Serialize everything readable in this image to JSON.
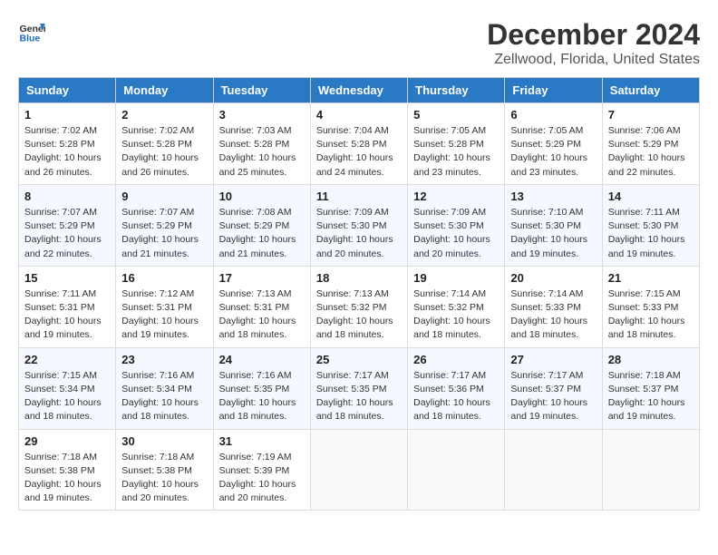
{
  "logo": {
    "line1": "General",
    "line2": "Blue"
  },
  "title": "December 2024",
  "subtitle": "Zellwood, Florida, United States",
  "days_header": [
    "Sunday",
    "Monday",
    "Tuesday",
    "Wednesday",
    "Thursday",
    "Friday",
    "Saturday"
  ],
  "weeks": [
    [
      {
        "day": "1",
        "sunrise": "7:02 AM",
        "sunset": "5:28 PM",
        "daylight": "10 hours and 26 minutes."
      },
      {
        "day": "2",
        "sunrise": "7:02 AM",
        "sunset": "5:28 PM",
        "daylight": "10 hours and 26 minutes."
      },
      {
        "day": "3",
        "sunrise": "7:03 AM",
        "sunset": "5:28 PM",
        "daylight": "10 hours and 25 minutes."
      },
      {
        "day": "4",
        "sunrise": "7:04 AM",
        "sunset": "5:28 PM",
        "daylight": "10 hours and 24 minutes."
      },
      {
        "day": "5",
        "sunrise": "7:05 AM",
        "sunset": "5:28 PM",
        "daylight": "10 hours and 23 minutes."
      },
      {
        "day": "6",
        "sunrise": "7:05 AM",
        "sunset": "5:29 PM",
        "daylight": "10 hours and 23 minutes."
      },
      {
        "day": "7",
        "sunrise": "7:06 AM",
        "sunset": "5:29 PM",
        "daylight": "10 hours and 22 minutes."
      }
    ],
    [
      {
        "day": "8",
        "sunrise": "7:07 AM",
        "sunset": "5:29 PM",
        "daylight": "10 hours and 22 minutes."
      },
      {
        "day": "9",
        "sunrise": "7:07 AM",
        "sunset": "5:29 PM",
        "daylight": "10 hours and 21 minutes."
      },
      {
        "day": "10",
        "sunrise": "7:08 AM",
        "sunset": "5:29 PM",
        "daylight": "10 hours and 21 minutes."
      },
      {
        "day": "11",
        "sunrise": "7:09 AM",
        "sunset": "5:30 PM",
        "daylight": "10 hours and 20 minutes."
      },
      {
        "day": "12",
        "sunrise": "7:09 AM",
        "sunset": "5:30 PM",
        "daylight": "10 hours and 20 minutes."
      },
      {
        "day": "13",
        "sunrise": "7:10 AM",
        "sunset": "5:30 PM",
        "daylight": "10 hours and 19 minutes."
      },
      {
        "day": "14",
        "sunrise": "7:11 AM",
        "sunset": "5:30 PM",
        "daylight": "10 hours and 19 minutes."
      }
    ],
    [
      {
        "day": "15",
        "sunrise": "7:11 AM",
        "sunset": "5:31 PM",
        "daylight": "10 hours and 19 minutes."
      },
      {
        "day": "16",
        "sunrise": "7:12 AM",
        "sunset": "5:31 PM",
        "daylight": "10 hours and 19 minutes."
      },
      {
        "day": "17",
        "sunrise": "7:13 AM",
        "sunset": "5:31 PM",
        "daylight": "10 hours and 18 minutes."
      },
      {
        "day": "18",
        "sunrise": "7:13 AM",
        "sunset": "5:32 PM",
        "daylight": "10 hours and 18 minutes."
      },
      {
        "day": "19",
        "sunrise": "7:14 AM",
        "sunset": "5:32 PM",
        "daylight": "10 hours and 18 minutes."
      },
      {
        "day": "20",
        "sunrise": "7:14 AM",
        "sunset": "5:33 PM",
        "daylight": "10 hours and 18 minutes."
      },
      {
        "day": "21",
        "sunrise": "7:15 AM",
        "sunset": "5:33 PM",
        "daylight": "10 hours and 18 minutes."
      }
    ],
    [
      {
        "day": "22",
        "sunrise": "7:15 AM",
        "sunset": "5:34 PM",
        "daylight": "10 hours and 18 minutes."
      },
      {
        "day": "23",
        "sunrise": "7:16 AM",
        "sunset": "5:34 PM",
        "daylight": "10 hours and 18 minutes."
      },
      {
        "day": "24",
        "sunrise": "7:16 AM",
        "sunset": "5:35 PM",
        "daylight": "10 hours and 18 minutes."
      },
      {
        "day": "25",
        "sunrise": "7:17 AM",
        "sunset": "5:35 PM",
        "daylight": "10 hours and 18 minutes."
      },
      {
        "day": "26",
        "sunrise": "7:17 AM",
        "sunset": "5:36 PM",
        "daylight": "10 hours and 18 minutes."
      },
      {
        "day": "27",
        "sunrise": "7:17 AM",
        "sunset": "5:37 PM",
        "daylight": "10 hours and 19 minutes."
      },
      {
        "day": "28",
        "sunrise": "7:18 AM",
        "sunset": "5:37 PM",
        "daylight": "10 hours and 19 minutes."
      }
    ],
    [
      {
        "day": "29",
        "sunrise": "7:18 AM",
        "sunset": "5:38 PM",
        "daylight": "10 hours and 19 minutes."
      },
      {
        "day": "30",
        "sunrise": "7:18 AM",
        "sunset": "5:38 PM",
        "daylight": "10 hours and 20 minutes."
      },
      {
        "day": "31",
        "sunrise": "7:19 AM",
        "sunset": "5:39 PM",
        "daylight": "10 hours and 20 minutes."
      },
      null,
      null,
      null,
      null
    ]
  ]
}
